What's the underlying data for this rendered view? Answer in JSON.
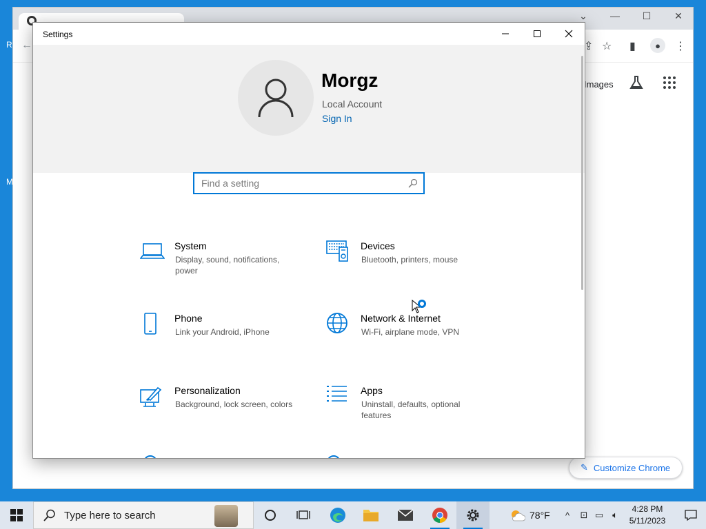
{
  "desktop": {
    "glyphs": [
      "R",
      "M"
    ]
  },
  "chrome": {
    "images_label": "Images",
    "customize_label": "Customize Chrome"
  },
  "settings": {
    "title": "Settings",
    "user": {
      "name": "Morgz",
      "account_type": "Local Account",
      "sign_in": "Sign In"
    },
    "search": {
      "placeholder": "Find a setting"
    },
    "tiles": [
      {
        "name": "System",
        "desc": "Display, sound, notifications, power",
        "icon": "laptop-icon"
      },
      {
        "name": "Devices",
        "desc": "Bluetooth, printers, mouse",
        "icon": "devices-icon"
      },
      {
        "name": "Phone",
        "desc": "Link your Android, iPhone",
        "icon": "phone-icon"
      },
      {
        "name": "Network & Internet",
        "desc": "Wi-Fi, airplane mode, VPN",
        "icon": "globe-icon"
      },
      {
        "name": "Personalization",
        "desc": "Background, lock screen, colors",
        "icon": "paintbrush-icon"
      },
      {
        "name": "Apps",
        "desc": "Uninstall, defaults, optional features",
        "icon": "apps-list-icon"
      }
    ],
    "accent": "#0078d7"
  },
  "taskbar": {
    "search_placeholder": "Type here to search",
    "weather": "78°F",
    "time": "4:28 PM",
    "date": "5/11/2023"
  }
}
